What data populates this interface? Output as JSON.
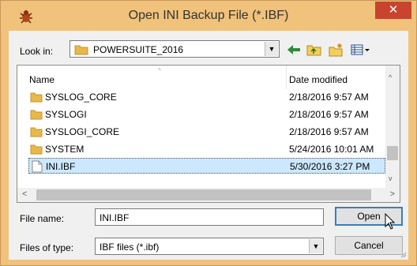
{
  "window": {
    "title": "Open INI Backup File (*.IBF)",
    "close_glyph": "✕",
    "icon": "bug-app-icon"
  },
  "lookin": {
    "label": "Look in:",
    "value": "POWERSUITE_2016",
    "dropdown_glyph": "▼"
  },
  "toolbar": {
    "icons": [
      "back-arrow-icon",
      "up-folder-icon",
      "new-folder-icon",
      "view-menu-icon"
    ]
  },
  "filelist": {
    "headers": {
      "name": "Name",
      "date": "Date modified",
      "sort_glyph": "^"
    },
    "rows": [
      {
        "name": "SYSLOG_CORE",
        "date": "2/18/2016 9:57 AM",
        "type": "folder"
      },
      {
        "name": "SYSLOGI",
        "date": "2/18/2016 9:57 AM",
        "type": "folder"
      },
      {
        "name": "SYSLOGI_CORE",
        "date": "2/18/2016 9:57 AM",
        "type": "folder"
      },
      {
        "name": "SYSTEM",
        "date": "5/24/2016 10:01 AM",
        "type": "folder"
      },
      {
        "name": "INI.IBF",
        "date": "5/30/2016 3:27 PM",
        "type": "file",
        "selected": true
      }
    ],
    "vscroll": {
      "up": "^",
      "down": "v"
    },
    "hscroll": {
      "left": "<",
      "right": ">"
    }
  },
  "filename": {
    "label": "File name:",
    "value": "INI.IBF"
  },
  "filetype": {
    "label": "Files of type:",
    "value": "IBF files (*.ibf)",
    "dropdown_glyph": "▼"
  },
  "buttons": {
    "open": "Open",
    "cancel": "Cancel"
  },
  "colors": {
    "frame": "#f0c27b",
    "close": "#c8442f",
    "selection": "#cce8ff",
    "folder": "#e8b84a"
  }
}
